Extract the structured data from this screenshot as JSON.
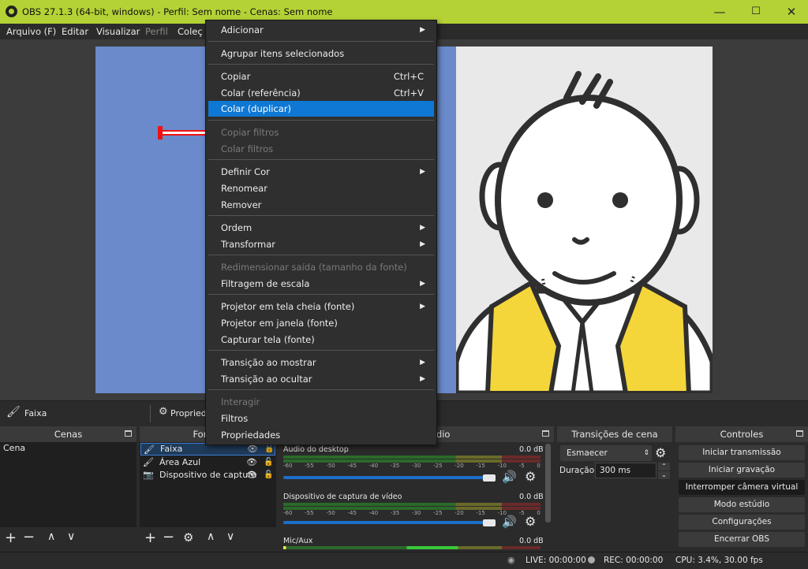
{
  "window": {
    "title": "OBS 27.1.3 (64-bit, windows) - Perfil: Sem nome - Cenas: Sem nome",
    "minimize": "—",
    "maximize": "☐",
    "close": "✕"
  },
  "menubar": [
    "Arquivo (F)",
    "Editar",
    "Visualizar",
    "Perfil",
    "Coleç"
  ],
  "context_menu": {
    "items": [
      {
        "label": "Adicionar",
        "submenu": true
      },
      {
        "label": "Agrupar itens selecionados"
      },
      {
        "label": "Copiar",
        "shortcut": "Ctrl+C"
      },
      {
        "label": "Colar (referência)",
        "shortcut": "Ctrl+V"
      },
      {
        "label": "Colar (duplicar)",
        "selected": true
      },
      {
        "label": "Copiar filtros",
        "disabled": true
      },
      {
        "label": "Colar filtros",
        "disabled": true
      },
      {
        "label": "Definir Cor",
        "submenu": true
      },
      {
        "label": "Renomear"
      },
      {
        "label": "Remover"
      },
      {
        "label": "Ordem",
        "submenu": true
      },
      {
        "label": "Transformar",
        "submenu": true
      },
      {
        "label": "Redimensionar saída (tamanho da fonte)",
        "disabled": true
      },
      {
        "label": "Filtragem de escala",
        "submenu": true
      },
      {
        "label": "Projetor em tela cheia (fonte)",
        "submenu": true
      },
      {
        "label": "Projetor em janela (fonte)"
      },
      {
        "label": "Capturar tela (fonte)"
      },
      {
        "label": "Transição ao mostrar",
        "submenu": true
      },
      {
        "label": "Transição ao ocultar",
        "submenu": true
      },
      {
        "label": "Interagir",
        "disabled": true
      },
      {
        "label": "Filtros"
      },
      {
        "label": "Propriedades"
      }
    ]
  },
  "source_toolbar": {
    "selected_source": "Faixa",
    "properties": "Propriedades"
  },
  "docks": {
    "scenes": {
      "title": "Cenas",
      "items": [
        "Cena"
      ]
    },
    "sources": {
      "title": "Fontes",
      "items": [
        {
          "name": "Faixa",
          "icon": "brush-icon"
        },
        {
          "name": "Área Azul",
          "icon": "brush-icon"
        },
        {
          "name": "Dispositivo de captura",
          "icon": "camera-icon"
        }
      ]
    },
    "mixer": {
      "title": "Mixer de áudio",
      "channels": [
        {
          "name": "Áudio do desktop",
          "db": "0.0 dB"
        },
        {
          "name": "Dispositivo de captura de vídeo",
          "db": "0.0 dB"
        },
        {
          "name": "Mic/Aux",
          "db": "0.0 dB"
        }
      ],
      "ticks": [
        "-60",
        "-55",
        "-50",
        "-45",
        "-40",
        "-35",
        "-30",
        "-25",
        "-20",
        "-15",
        "-10",
        "-5",
        "0"
      ]
    },
    "transitions": {
      "title": "Transições de cena",
      "selected": "Esmaecer",
      "duration_label": "Duração",
      "duration_value": "300 ms"
    },
    "controls": {
      "title": "Controles",
      "buttons": [
        "Iniciar transmissão",
        "Iniciar gravação",
        "Interromper câmera virtual",
        "Modo estúdio",
        "Configurações",
        "Encerrar OBS"
      ]
    }
  },
  "status": {
    "live": "LIVE: 00:00:00",
    "rec": "REC: 00:00:00",
    "cpu": "CPU: 3.4%, 30.00 fps"
  },
  "colors": {
    "titlebar": "#b4d235",
    "selection": "#0e78d4",
    "canvas_blue": "#6a8acb",
    "vest_yellow": "#f5d63a"
  }
}
